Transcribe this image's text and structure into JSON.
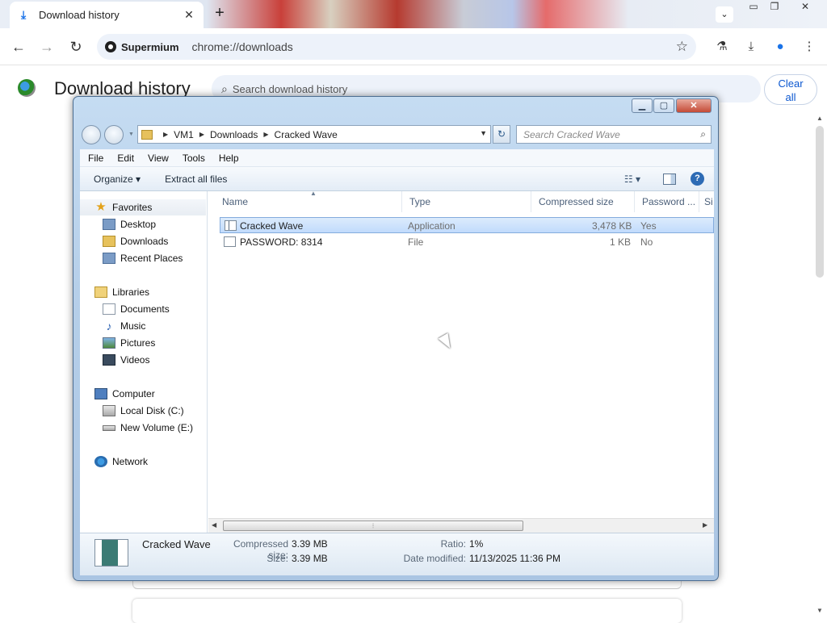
{
  "browser": {
    "tab_title": "Download history",
    "tab_close": "✕",
    "new_tab": "+",
    "site_name": "Supermium",
    "url": "chrome://downloads"
  },
  "downloads_page": {
    "heading": "Download history",
    "search_placeholder": "Search download history",
    "clear_all_line1": "Clear",
    "clear_all_line2": "all"
  },
  "explorer": {
    "breadcrumb": [
      "VM1",
      "Downloads",
      "Cracked Wave"
    ],
    "search_placeholder": "Search Cracked Wave",
    "menu": [
      "File",
      "Edit",
      "View",
      "Tools",
      "Help"
    ],
    "commands": {
      "organize": "Organize ▾",
      "extract": "Extract all files"
    },
    "nav": {
      "favorites": "Favorites",
      "desktop": "Desktop",
      "downloads": "Downloads",
      "recent": "Recent Places",
      "libraries": "Libraries",
      "documents": "Documents",
      "music": "Music",
      "pictures": "Pictures",
      "videos": "Videos",
      "computer": "Computer",
      "local_disk": "Local Disk (C:)",
      "new_volume": "New Volume (E:)",
      "network": "Network"
    },
    "columns": {
      "name": "Name",
      "type": "Type",
      "compressed": "Compressed size",
      "password": "Password ...",
      "size": "Si"
    },
    "files": [
      {
        "name": "Cracked Wave",
        "type": "Application",
        "compressed": "3,478 KB",
        "password": "Yes"
      },
      {
        "name": "PASSWORD: 8314",
        "type": "File",
        "compressed": "1 KB",
        "password": "No"
      }
    ],
    "details": {
      "name": "Cracked Wave",
      "compressed_label": "Compressed size:",
      "compressed_value": "3.39 MB",
      "size_label": "Size:",
      "size_value": "3.39 MB",
      "ratio_label": "Ratio:",
      "ratio_value": "1%",
      "date_label": "Date modified:",
      "date_value": "11/13/2025 11:36 PM"
    }
  }
}
